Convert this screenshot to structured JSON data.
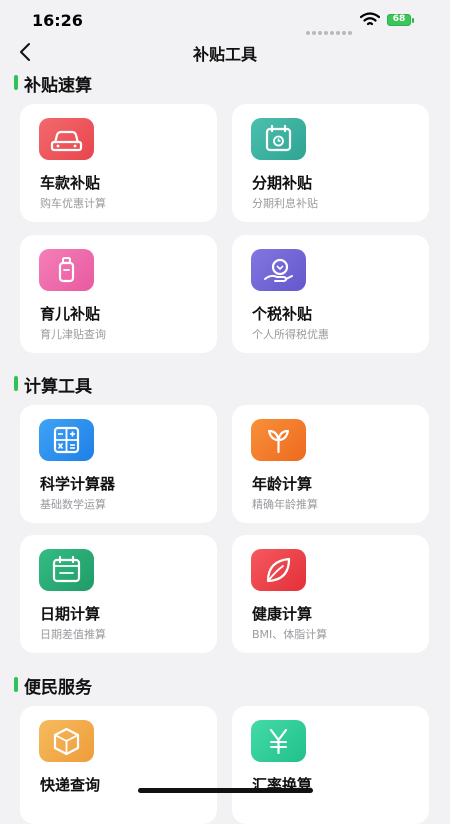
{
  "status": {
    "time": "16:26",
    "battery": "68"
  },
  "nav": {
    "title": "补贴工具"
  },
  "sections": [
    {
      "title": "补贴速算"
    },
    {
      "title": "计算工具"
    },
    {
      "title": "便民服务"
    }
  ],
  "cards": [
    {
      "title": "车款补贴",
      "subtitle": "购车优惠计算",
      "icon": "car-icon",
      "color": "#ef5f63"
    },
    {
      "title": "分期补贴",
      "subtitle": "分期利息补贴",
      "icon": "calendar-clock-icon",
      "color": "#3cb5a4"
    },
    {
      "title": "育儿补贴",
      "subtitle": "育儿津贴查询",
      "icon": "baby-bottle-icon",
      "color": "#ef6fae"
    },
    {
      "title": "个税补贴",
      "subtitle": "个人所得税优惠",
      "icon": "tax-coin-icon",
      "color": "#7468d8"
    },
    {
      "title": "科学计算器",
      "subtitle": "基础数学运算",
      "icon": "calculator-icon",
      "color": "#2f8fef"
    },
    {
      "title": "年龄计算",
      "subtitle": "精确年龄推算",
      "icon": "sprout-icon",
      "color": "#f37a2a"
    },
    {
      "title": "日期计算",
      "subtitle": "日期差值推算",
      "icon": "calendar-icon",
      "color": "#27ad76"
    },
    {
      "title": "健康计算",
      "subtitle": "BMI、体脂计算",
      "icon": "leaf-icon",
      "color": "#ef3f46"
    },
    {
      "title": "快递查询",
      "subtitle": "",
      "icon": "package-icon",
      "color": "#f2a84a"
    },
    {
      "title": "汇率换算",
      "subtitle": "",
      "icon": "yuan-icon",
      "color": "#2fcf9b"
    }
  ]
}
